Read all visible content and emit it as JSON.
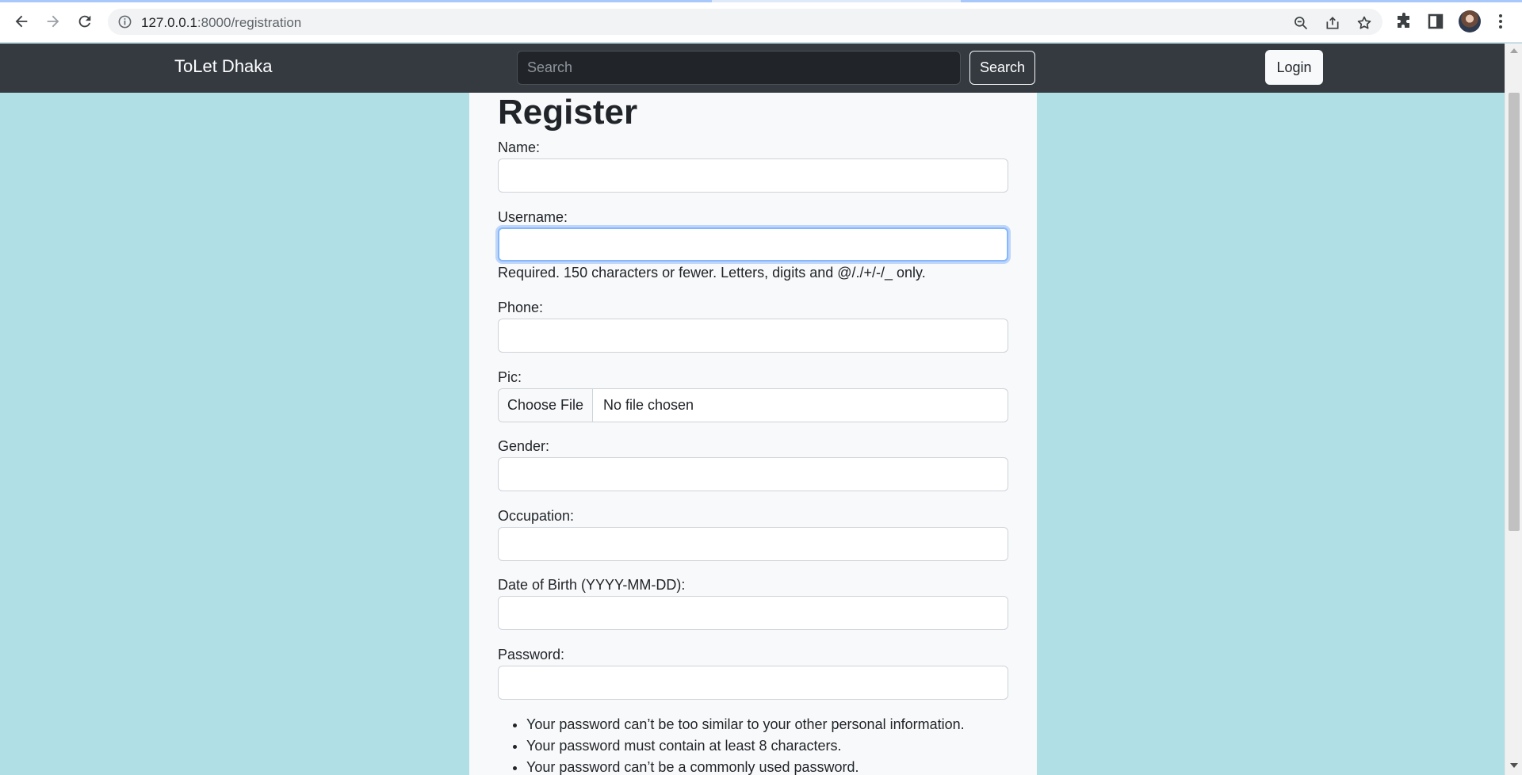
{
  "browser": {
    "url_host": "127.0.0.1",
    "url_path": ":8000/registration"
  },
  "navbar": {
    "brand": "ToLet Dhaka",
    "search_placeholder": "Search",
    "search_button": "Search",
    "login_button": "Login"
  },
  "form": {
    "title": "Register",
    "name_label": "Name:",
    "username_label": "Username:",
    "username_help": "Required. 150 characters or fewer. Letters, digits and @/./+/-/_ only.",
    "phone_label": "Phone:",
    "pic_label": "Pic:",
    "pic_choose": "Choose File",
    "pic_status": "No file chosen",
    "gender_label": "Gender:",
    "occupation_label": "Occupation:",
    "dob_label": "Date of Birth (YYYY-MM-DD):",
    "password_label": "Password:",
    "password_rules": [
      "Your password can’t be too similar to your other personal information.",
      "Your password must contain at least 8 characters.",
      "Your password can’t be a commonly used password."
    ]
  },
  "icons": {
    "back": "arrow-left-icon",
    "forward": "arrow-right-icon",
    "reload": "reload-icon",
    "site_info": "info-icon",
    "zoom": "zoom-out-icon",
    "share": "share-icon",
    "bookmark": "star-icon",
    "extensions": "puzzle-icon",
    "side_panel": "side-panel-icon",
    "menu": "kebab-menu-icon"
  }
}
